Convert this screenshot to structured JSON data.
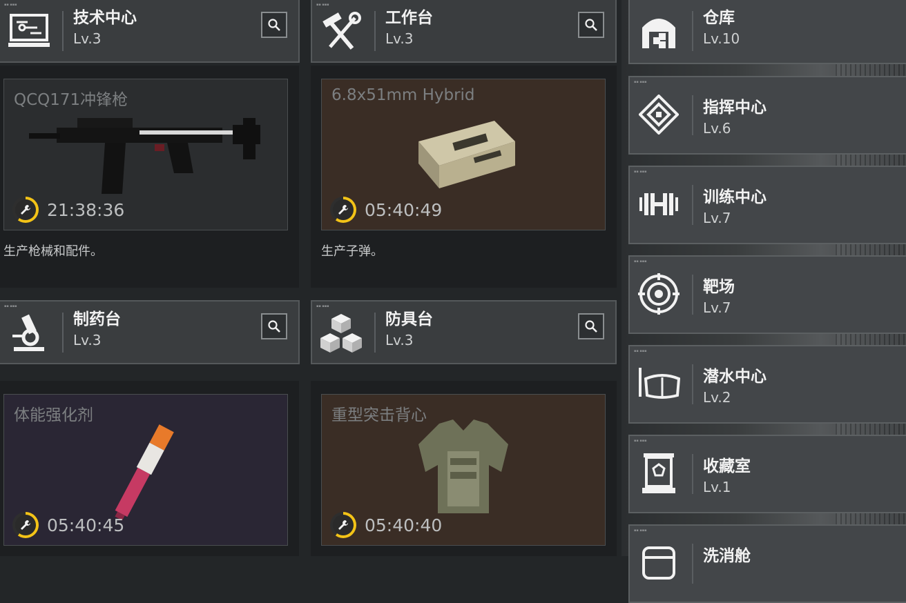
{
  "facilities_left": [
    {
      "name": "技术中心",
      "level": "Lv.3",
      "icon": "computer-icon"
    },
    {
      "name": "工作台",
      "level": "Lv.3",
      "icon": "hammer-wrench-icon"
    },
    {
      "name": "制药台",
      "level": "Lv.3",
      "icon": "microscope-icon"
    },
    {
      "name": "防具台",
      "level": "Lv.3",
      "icon": "cubes-icon"
    }
  ],
  "production": [
    {
      "item": "QCQ171冲锋枪",
      "time": "21:38:36",
      "progress": 0.6,
      "description": "生产枪械和配件。",
      "image": "smg-icon"
    },
    {
      "item": "6.8x51mm Hybrid",
      "time": "05:40:49",
      "progress": 0.6,
      "description": "生产子弹。",
      "image": "ammo-box-icon"
    },
    {
      "item": "体能强化剂",
      "time": "05:40:45",
      "progress": 0.6,
      "description": "",
      "image": "injector-icon"
    },
    {
      "item": "重型突击背心",
      "time": "05:40:40",
      "progress": 0.6,
      "description": "",
      "image": "vest-icon"
    }
  ],
  "facilities_right": [
    {
      "name": "仓库",
      "level": "Lv.10",
      "icon": "warehouse-icon"
    },
    {
      "name": "指挥中心",
      "level": "Lv.6",
      "icon": "command-icon"
    },
    {
      "name": "训练中心",
      "level": "Lv.7",
      "icon": "dumbbell-icon"
    },
    {
      "name": "靶场",
      "level": "Lv.7",
      "icon": "target-icon"
    },
    {
      "name": "潜水中心",
      "level": "Lv.2",
      "icon": "diving-mask-icon"
    },
    {
      "name": "收藏室",
      "level": "Lv.1",
      "icon": "display-case-icon"
    },
    {
      "name": "洗消舱",
      "level": "",
      "icon": "decon-icon"
    }
  ],
  "colors": {
    "accent_timer": "#f3c317",
    "card_dark": "#2b2d2f",
    "card_brown": "#3a2d25",
    "card_purple": "#2a2634"
  }
}
